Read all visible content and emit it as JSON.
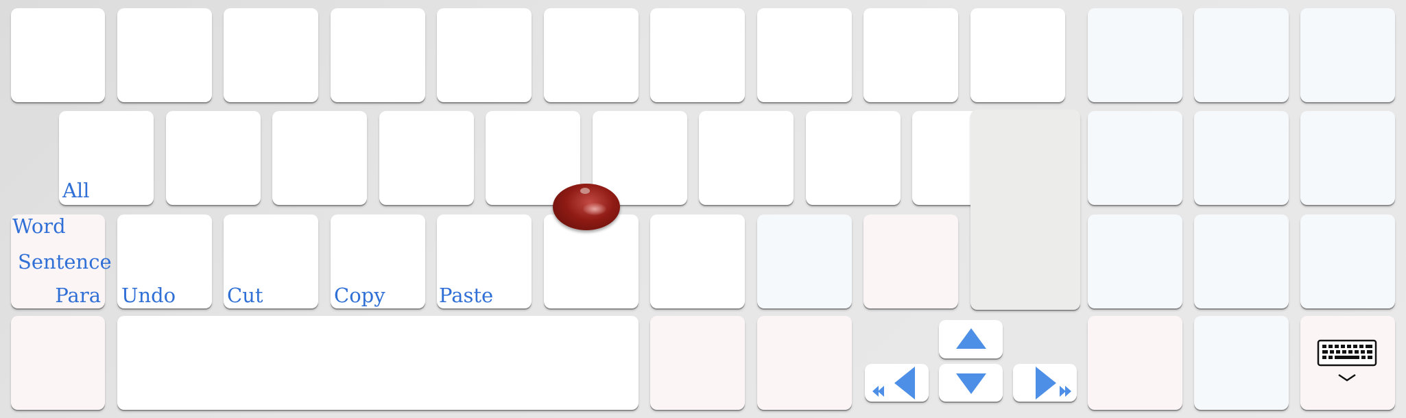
{
  "labels": {
    "select_all": "All",
    "word": "Word",
    "sentence": "Sentence",
    "para": "Para",
    "undo": "Undo",
    "cut": "Cut",
    "copy": "Copy",
    "paste": "Paste"
  },
  "icons": {
    "up": "arrow-up",
    "down": "arrow-down",
    "left": "arrow-left-with-home",
    "right": "arrow-right-with-end",
    "hide_keyboard": "keyboard-hide"
  },
  "colors": {
    "label_blue": "#2f6fd6",
    "arrow_blue": "#4d8fe6",
    "key_white": "#ffffff",
    "key_blue_tint": "#f5f9fc",
    "key_pink_tint": "#fcf5f6",
    "key_gray": "#ececea",
    "pointer": "#8f1b14"
  }
}
